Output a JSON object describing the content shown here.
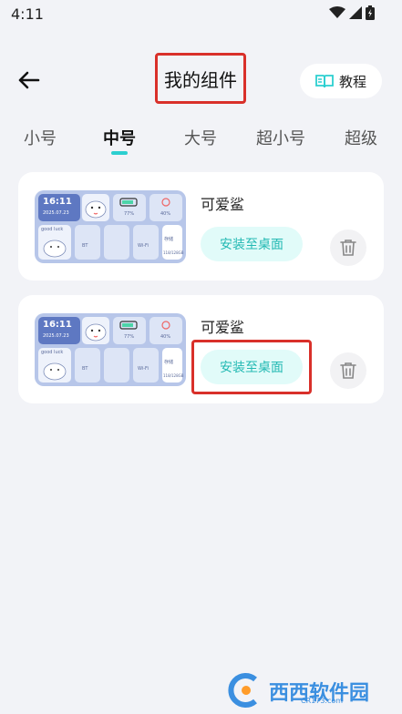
{
  "status_bar": {
    "time": "4:11"
  },
  "header": {
    "title": "我的组件",
    "tutorial_label": "教程"
  },
  "tabs": [
    {
      "label": "小号",
      "active": false
    },
    {
      "label": "中号",
      "active": true
    },
    {
      "label": "大号",
      "active": false
    },
    {
      "label": "超小号",
      "active": false
    },
    {
      "label": "超级",
      "active": false
    }
  ],
  "widgets": [
    {
      "name": "可爱鲨",
      "install_label": "安装至桌面",
      "preview": {
        "time": "16:11",
        "date": "2025.07.23",
        "battery": "77%",
        "temp": "40%",
        "greeting": "good luck",
        "bt": "BT",
        "wifi": "Wi-Fi",
        "storage": "118/128GB",
        "storage_label": "存储"
      }
    },
    {
      "name": "可爱鲨",
      "install_label": "安装至桌面",
      "preview": {
        "time": "16:11",
        "date": "2025.07.23",
        "battery": "77%",
        "temp": "40%",
        "greeting": "good luck",
        "bt": "BT",
        "wifi": "Wi-Fi",
        "storage": "118/128GB",
        "storage_label": "存储"
      }
    }
  ],
  "watermark": {
    "text": "西西软件园",
    "sub": "CR173.com"
  },
  "colors": {
    "accent": "#2ccfd0",
    "install_bg": "#e1fbf9",
    "install_text": "#23b9b3",
    "highlight": "#d9302a"
  }
}
